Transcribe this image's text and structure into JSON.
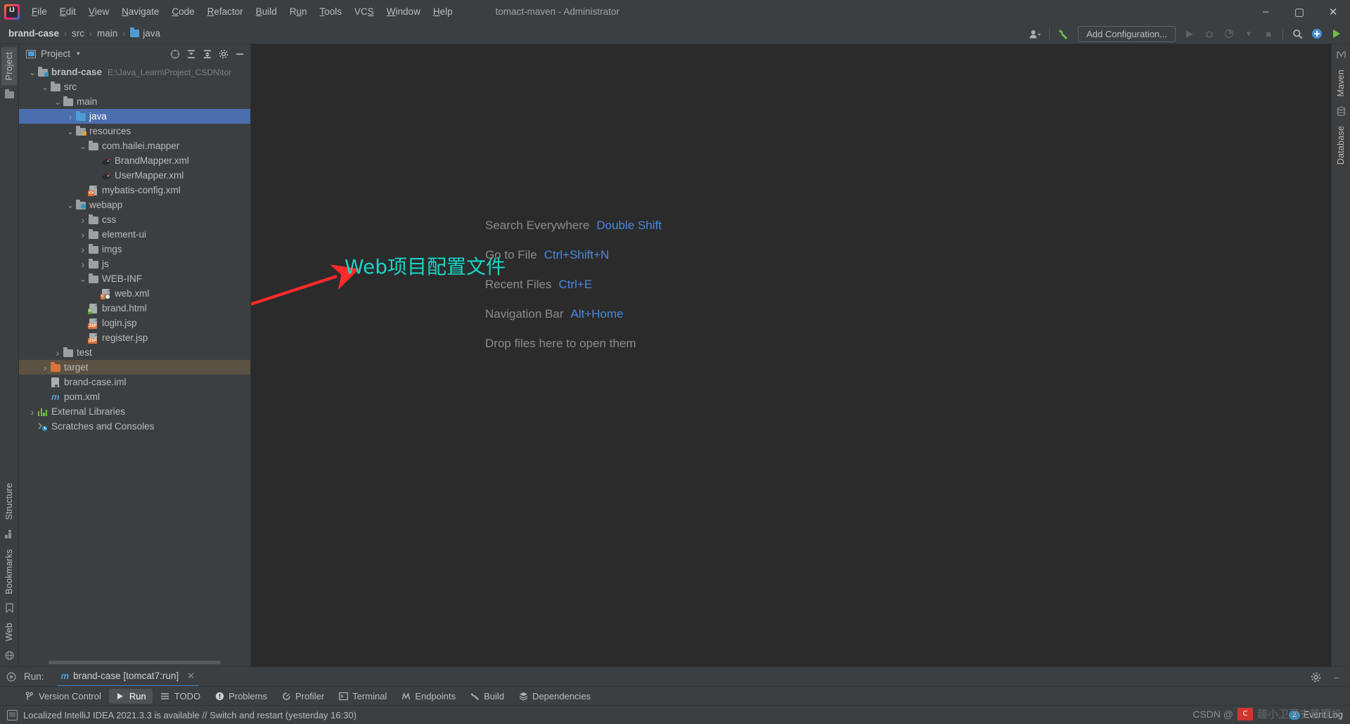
{
  "window": {
    "title": "tomact-maven - Administrator",
    "minimize": "–",
    "maximize": "▢",
    "close": "✕"
  },
  "menubar": {
    "items": [
      {
        "label": "File",
        "mnemonic": "F"
      },
      {
        "label": "Edit",
        "mnemonic": "E"
      },
      {
        "label": "View",
        "mnemonic": "V"
      },
      {
        "label": "Navigate",
        "mnemonic": "N"
      },
      {
        "label": "Code",
        "mnemonic": "C"
      },
      {
        "label": "Refactor",
        "mnemonic": "R"
      },
      {
        "label": "Build",
        "mnemonic": "B"
      },
      {
        "label": "Run",
        "mnemonic": "u"
      },
      {
        "label": "Tools",
        "mnemonic": "T"
      },
      {
        "label": "VCS",
        "mnemonic": "S"
      },
      {
        "label": "Window",
        "mnemonic": "W"
      },
      {
        "label": "Help",
        "mnemonic": "H"
      }
    ]
  },
  "breadcrumb": {
    "items": [
      "brand-case",
      "src",
      "main",
      "java"
    ],
    "separator": "›"
  },
  "toolbar": {
    "add_configuration": "Add Configuration...",
    "run_icon": "▶",
    "debug_icon": "🐞",
    "run_coverage_icon": "▶",
    "more_icon": "▾",
    "stop_icon": "■",
    "search_icon": "🔍",
    "updates_icon": "+",
    "ide_icon": "▶",
    "user_icon": "person-silhouette",
    "hammer_icon": "hammer"
  },
  "left_rail": {
    "tabs": [
      "Project",
      "Structure",
      "Bookmarks",
      "Web"
    ]
  },
  "right_rail": {
    "tabs": [
      "Maven",
      "Database"
    ]
  },
  "project_panel": {
    "title": "Project",
    "caret": "▾",
    "tools": [
      "select-opened-file",
      "expand-all",
      "collapse-all",
      "settings",
      "hide"
    ],
    "tree": [
      {
        "depth": 0,
        "arrow": "v",
        "icon": "module",
        "label": "brand-case",
        "path": "E:\\Java_Learn\\Project_CSDN\\tor",
        "bold": true,
        "state": "normal"
      },
      {
        "depth": 1,
        "arrow": "v",
        "icon": "folder",
        "label": "src",
        "state": "normal"
      },
      {
        "depth": 2,
        "arrow": "v",
        "icon": "folder",
        "label": "main",
        "state": "normal"
      },
      {
        "depth": 3,
        "arrow": ">",
        "icon": "folder-blue",
        "label": "java",
        "state": "selected"
      },
      {
        "depth": 3,
        "arrow": "v",
        "icon": "folder-resources",
        "label": "resources",
        "state": "normal"
      },
      {
        "depth": 4,
        "arrow": "v",
        "icon": "folder",
        "label": "com.hailei.mapper",
        "state": "normal"
      },
      {
        "depth": 5,
        "arrow": "",
        "icon": "mybatis-bird",
        "label": "BrandMapper.xml",
        "state": "normal"
      },
      {
        "depth": 5,
        "arrow": "",
        "icon": "mybatis-bird",
        "label": "UserMapper.xml",
        "state": "normal"
      },
      {
        "depth": 4,
        "arrow": "",
        "icon": "xml-file",
        "label": "mybatis-config.xml",
        "state": "normal"
      },
      {
        "depth": 3,
        "arrow": "v",
        "icon": "folder-web",
        "label": "webapp",
        "state": "normal"
      },
      {
        "depth": 4,
        "arrow": ">",
        "icon": "folder",
        "label": "css",
        "state": "normal"
      },
      {
        "depth": 4,
        "arrow": ">",
        "icon": "folder",
        "label": "element-ui",
        "state": "normal"
      },
      {
        "depth": 4,
        "arrow": ">",
        "icon": "folder",
        "label": "imgs",
        "state": "normal"
      },
      {
        "depth": 4,
        "arrow": ">",
        "icon": "folder",
        "label": "js",
        "state": "normal"
      },
      {
        "depth": 4,
        "arrow": "v",
        "icon": "folder",
        "label": "WEB-INF",
        "state": "normal"
      },
      {
        "depth": 5,
        "arrow": "",
        "icon": "webxml-file",
        "label": "web.xml",
        "state": "normal"
      },
      {
        "depth": 4,
        "arrow": "",
        "icon": "html-file",
        "label": "brand.html",
        "state": "normal"
      },
      {
        "depth": 4,
        "arrow": "",
        "icon": "jsp-file",
        "label": "login.jsp",
        "state": "normal"
      },
      {
        "depth": 4,
        "arrow": "",
        "icon": "jsp-file",
        "label": "register.jsp",
        "state": "normal"
      },
      {
        "depth": 2,
        "arrow": ">",
        "icon": "folder",
        "label": "test",
        "state": "normal"
      },
      {
        "depth": 1,
        "arrow": ">",
        "icon": "folder-orange",
        "label": "target",
        "state": "highlight"
      },
      {
        "depth": 1,
        "arrow": "",
        "icon": "iml-file",
        "label": "brand-case.iml",
        "state": "normal"
      },
      {
        "depth": 1,
        "arrow": "",
        "icon": "maven-m",
        "label": "pom.xml",
        "state": "normal"
      },
      {
        "depth": 0,
        "arrow": ">",
        "icon": "libraries",
        "label": "External Libraries",
        "state": "normal"
      },
      {
        "depth": 0,
        "arrow": "",
        "icon": "scratches",
        "label": "Scratches and Consoles",
        "state": "normal"
      }
    ]
  },
  "editor": {
    "annotation": "Web项目配置文件",
    "annotation_color": "#17d6c6",
    "arrow_color": "#ff2b2b",
    "tips": [
      {
        "label": "Search Everywhere",
        "shortcut": "Double Shift"
      },
      {
        "label": "Go to File",
        "shortcut": "Ctrl+Shift+N"
      },
      {
        "label": "Recent Files",
        "shortcut": "Ctrl+E"
      },
      {
        "label": "Navigation Bar",
        "shortcut": "Alt+Home"
      }
    ],
    "drop_hint": "Drop files here to open them"
  },
  "run_window": {
    "label": "Run:",
    "tab_label": "brand-case [tomcat7:run]",
    "tab_icon": "m",
    "close_icon": "✕",
    "settings_icon": "⚙",
    "hide_icon": "–"
  },
  "bottom_tabs": [
    {
      "label": "Version Control",
      "icon": "branch-icon",
      "active": false
    },
    {
      "label": "Run",
      "icon": "play-icon",
      "active": true
    },
    {
      "label": "TODO",
      "icon": "list-icon",
      "active": false
    },
    {
      "label": "Problems",
      "icon": "warning-icon",
      "active": false
    },
    {
      "label": "Profiler",
      "icon": "profiler-icon",
      "active": false
    },
    {
      "label": "Terminal",
      "icon": "terminal-icon",
      "active": false
    },
    {
      "label": "Endpoints",
      "icon": "endpoints-icon",
      "active": false
    },
    {
      "label": "Build",
      "icon": "build-icon",
      "active": false
    },
    {
      "label": "Dependencies",
      "icon": "dependencies-icon",
      "active": false
    }
  ],
  "statusbar": {
    "message": "Localized IntelliJ IDEA 2021.3.3 is available // Switch and restart (yesterday 16:30)",
    "event_log": "Event Log",
    "event_count": "2"
  },
  "watermark": {
    "prefix": "CSDN @",
    "text": "趣小卫哥支管理机"
  }
}
